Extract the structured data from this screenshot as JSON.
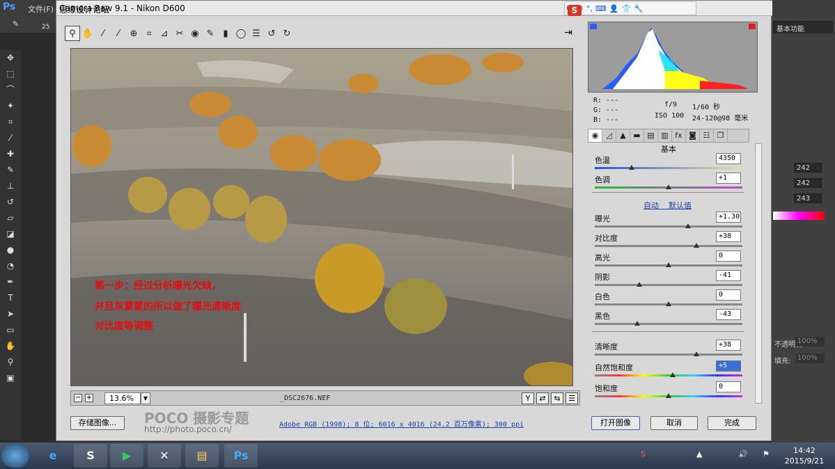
{
  "ps": {
    "logo": "Ps",
    "menu_file": "文件(F)",
    "brush_size": "25",
    "workspace": "基本功能",
    "rgb_vals": [
      "242",
      "242",
      "243"
    ],
    "opacity_label": "不透明度:",
    "opacity_val": "100%",
    "fill_label": "填充:",
    "fill_val": "100%"
  },
  "dialog": {
    "title": "Camera Raw 9.1 -  Nikon D600"
  },
  "ime": {
    "logo": "S",
    "icons": [
      "中",
      "☽",
      "°,",
      "⌨",
      "👤",
      "👕",
      "🔧"
    ]
  },
  "watermark": "思缘设计论坛",
  "watermark2": "www.MISSYUAN.COM",
  "annotation": {
    "line1": "第一步：经过分析曝光欠缺，",
    "line2": "并且灰蒙蒙的所以做了曝光清晰度",
    "line3": "对比度等调整"
  },
  "statusbar": {
    "zoom": "13.6%",
    "filename": "_DSC2676.NEF"
  },
  "exif": {
    "r": "R:  ---",
    "g": "G:  ---",
    "b": "B:  ---",
    "aperture": "f/9",
    "shutter": "1/60 秒",
    "iso": "ISO 100",
    "lens": "24-120@98 毫米"
  },
  "panel": {
    "title": "基本",
    "auto": "自动",
    "default": "默认值",
    "controls": [
      {
        "label": "色温",
        "value": "4350",
        "pos": 0.25,
        "track": "temp"
      },
      {
        "label": "色调",
        "value": "+1",
        "pos": 0.5,
        "track": "tint"
      },
      {
        "label": "曝光",
        "value": "+1.30",
        "pos": 0.63,
        "track": "gray"
      },
      {
        "label": "对比度",
        "value": "+38",
        "pos": 0.69,
        "track": "gray"
      },
      {
        "label": "高光",
        "value": "0",
        "pos": 0.5,
        "track": "gray"
      },
      {
        "label": "阴影",
        "value": "-41",
        "pos": 0.3,
        "track": "gray"
      },
      {
        "label": "白色",
        "value": "0",
        "pos": 0.5,
        "track": "gray"
      },
      {
        "label": "黑色",
        "value": "-43",
        "pos": 0.29,
        "track": "gray"
      },
      {
        "label": "清晰度",
        "value": "+38",
        "pos": 0.69,
        "track": "gray"
      },
      {
        "label": "自然饱和度",
        "value": "+5",
        "pos": 0.53,
        "track": "sat",
        "highlight": true
      },
      {
        "label": "饱和度",
        "value": "0",
        "pos": 0.5,
        "track": "sat"
      }
    ]
  },
  "buttons": {
    "save": "存储图像...",
    "open": "打开图像",
    "cancel": "取消",
    "done": "完成"
  },
  "poco": {
    "brand": "POCO 摄影专题",
    "url": "http://photo.poco.cn/"
  },
  "color_info": "Adobe RGB (1998); 8 位; 6016 x 4016 (24.2 百万像素); 300 ppi",
  "clock": {
    "time": "14:42",
    "date": "2015/9/21"
  }
}
